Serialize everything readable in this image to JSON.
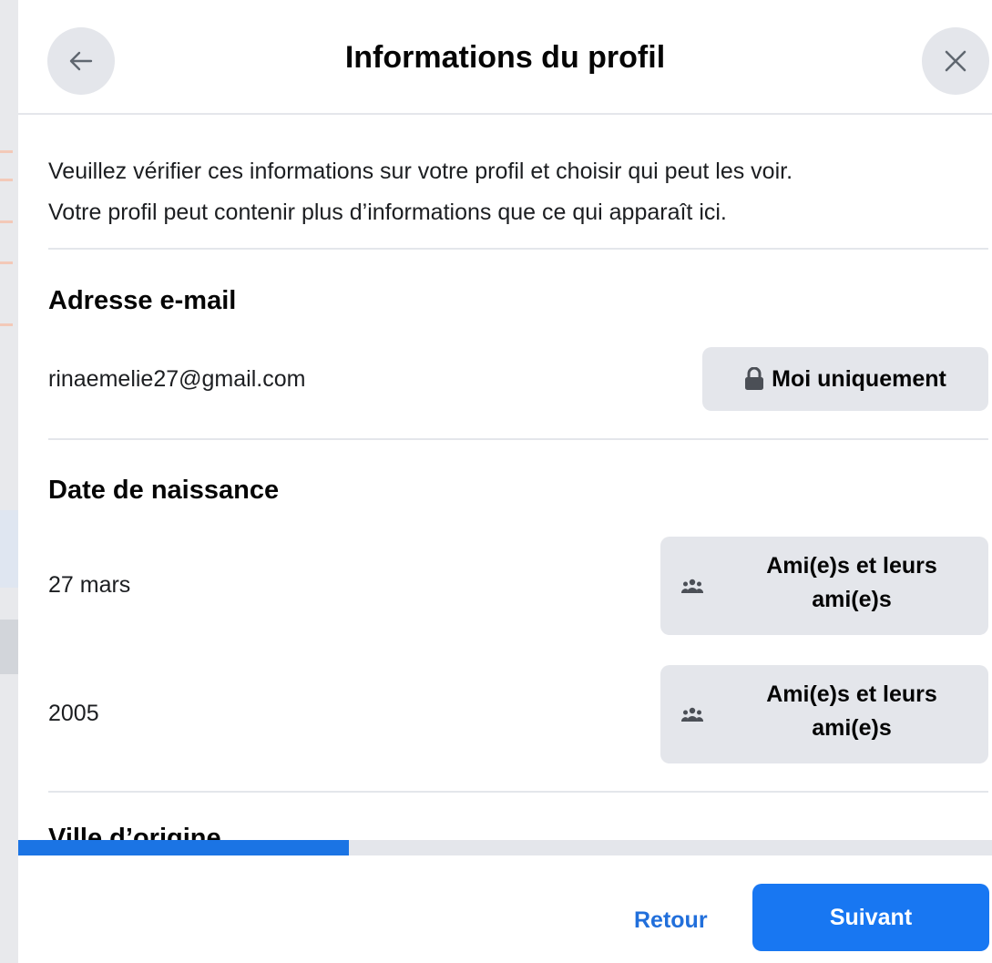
{
  "header": {
    "title": "Informations du profil"
  },
  "intro": {
    "line1": "Veuillez vérifier ces informations sur votre profil et choisir qui peut les voir.",
    "line2": "Votre profil peut contenir plus d’informations que ce qui apparaît ici."
  },
  "email_section": {
    "title": "Adresse e-mail",
    "value": "rinaemelie27@gmail.com",
    "audience": {
      "label": "Moi uniquement",
      "icon": "lock-icon"
    }
  },
  "birthday_section": {
    "title": "Date de naissance",
    "rows": [
      {
        "value": "27 mars",
        "audience": {
          "line1": "Ami(e)s et leurs",
          "line2": "ami(e)s",
          "icon": "friends-icon"
        }
      },
      {
        "value": "2005",
        "audience": {
          "line1": "Ami(e)s et leurs",
          "line2": "ami(e)s",
          "icon": "friends-icon"
        }
      }
    ]
  },
  "next_section": {
    "title": "Ville d’origine"
  },
  "progress": {
    "percent": 34
  },
  "footer": {
    "back_label": "Retour",
    "next_label": "Suivant"
  },
  "colors": {
    "primary": "#1877f2",
    "link": "#216fdb",
    "progress": "#1b74e4",
    "button_gray": "#e4e6eb"
  }
}
